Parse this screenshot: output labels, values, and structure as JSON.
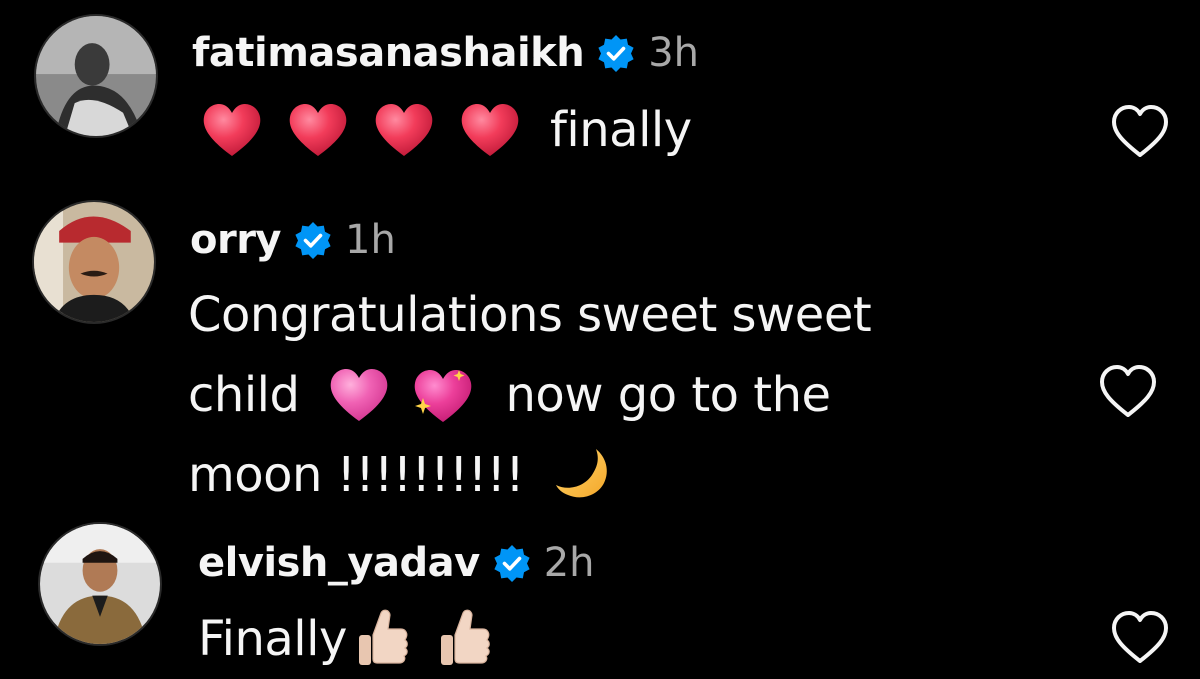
{
  "comments": [
    {
      "username": "fatimasanashaikh",
      "verified": true,
      "time": "3h",
      "text": "finally",
      "emojis": [
        "red-heart",
        "red-heart",
        "red-heart",
        "red-heart"
      ]
    },
    {
      "username": "orry",
      "verified": true,
      "time": "1h",
      "line1": "Congratulations sweet sweet",
      "line2a": "child",
      "line2b": "now go to the",
      "line3": "moon !!!!!!!!!!",
      "emojis": [
        "pink-heart",
        "sparkling-heart",
        "crescent-moon"
      ]
    },
    {
      "username": "elvish_yadav",
      "verified": true,
      "time": "2h",
      "text": "Finally",
      "emojis": [
        "thumbs-up-light",
        "thumbs-up-light"
      ]
    }
  ],
  "colors": {
    "background": "#000000",
    "text": "#f5f5f5",
    "muted": "#a8a8a8",
    "verified_blue": "#0095f6",
    "heart_red": "#e8344e"
  },
  "icons": {
    "like": "heart-outline-icon",
    "verified": "verified-badge-icon"
  }
}
